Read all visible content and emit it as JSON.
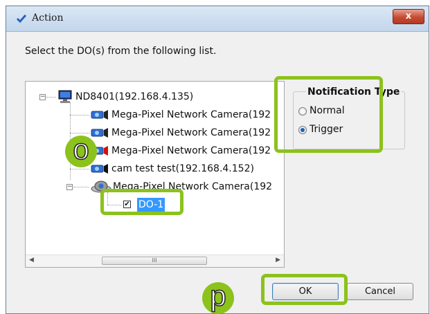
{
  "window": {
    "title": "Action",
    "close_label": "x"
  },
  "instruction": "Select the DO(s) from the following list.",
  "tree": {
    "root": {
      "label": "ND8401(192.168.4.135)",
      "expander": "−"
    },
    "cameras": [
      {
        "label": "Mega-Pixel Network Camera(192"
      },
      {
        "label": "Mega-Pixel Network Camera(192"
      },
      {
        "label": "Mega-Pixel Network Camera(192"
      },
      {
        "label": "cam test test(192.168.4.152)"
      },
      {
        "label": "Mega-Pixel Network Camera(192",
        "expander": "−"
      }
    ],
    "do_item": {
      "label": "DO-1",
      "checked": true,
      "check_mark": "✔"
    }
  },
  "scrollbar": {
    "left_arrow": "◀",
    "right_arrow": "▶",
    "thumb_grip": "III"
  },
  "notification": {
    "legend": "Notification Type",
    "options": [
      {
        "label": "Normal",
        "checked": false
      },
      {
        "label": "Trigger",
        "checked": true
      }
    ]
  },
  "buttons": {
    "ok": "OK",
    "cancel": "Cancel"
  },
  "markers": {
    "o": "o",
    "p": "p"
  },
  "colors": {
    "highlight": "#8cc21c",
    "selection": "#3399ff",
    "titlebar": "#c3d6ec"
  }
}
